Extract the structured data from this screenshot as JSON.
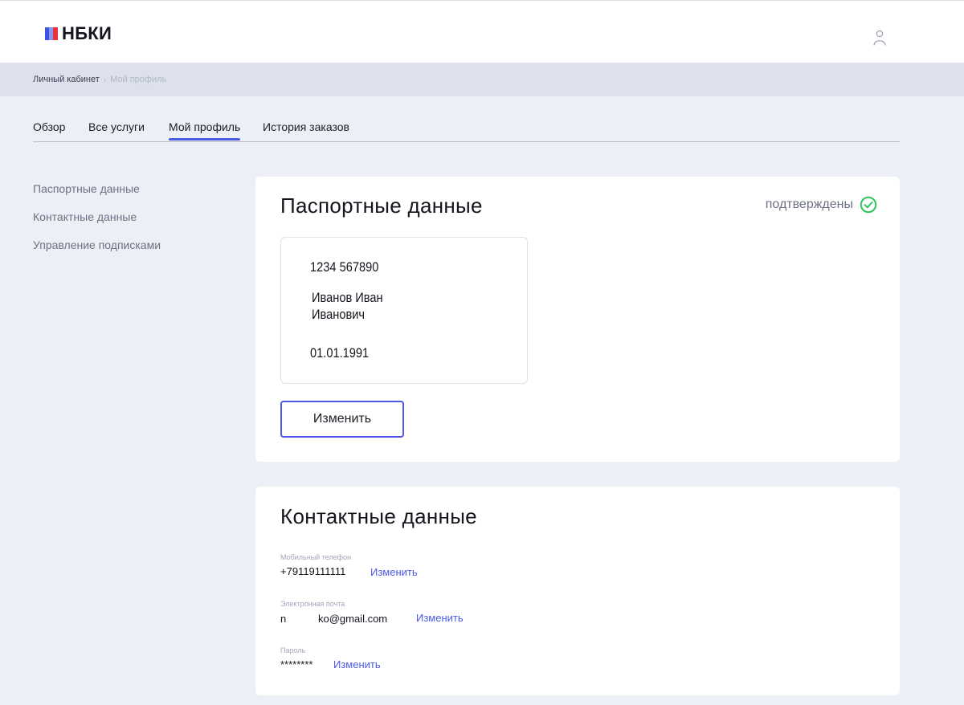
{
  "header": {
    "logo_text": "НБКИ",
    "user_icon": "person-icon"
  },
  "breadcrumb": {
    "root": "Личный кабинет",
    "separator": "›",
    "current": "Мой профиль"
  },
  "tabs": [
    {
      "label": "Обзор",
      "active": false
    },
    {
      "label": "Все услуги",
      "active": false
    },
    {
      "label": "Мой профиль",
      "active": true
    },
    {
      "label": "История заказов",
      "active": false
    }
  ],
  "sidenav": {
    "items": [
      {
        "label": "Паспортные данные"
      },
      {
        "label": "Контактные данные"
      },
      {
        "label": "Управление подписками"
      }
    ]
  },
  "passport": {
    "title": "Паспортные данные",
    "status_text": "подтверждены",
    "status_icon": "check-circle-icon",
    "number": "1234 567890",
    "name_line1": "Иванов Иван",
    "name_line2": "Иванович",
    "birth_date": "01.01.1991",
    "edit_label": "Изменить"
  },
  "contacts": {
    "title": "Контактные данные",
    "phone": {
      "label": "Мобильный телефон",
      "value": "+79119111111",
      "edit_label": "Изменить"
    },
    "email": {
      "label": "Электронная почта",
      "value": "n           ko@gmail.com",
      "edit_label": "Изменить"
    },
    "password": {
      "label": "Пароль",
      "value": "********",
      "edit_label": "Изменить"
    }
  },
  "colors": {
    "accent": "#4a5ae4",
    "status_green": "#2ec55b",
    "page_bg": "#eceff6",
    "breadcrumb_bg": "#dde1ec"
  }
}
